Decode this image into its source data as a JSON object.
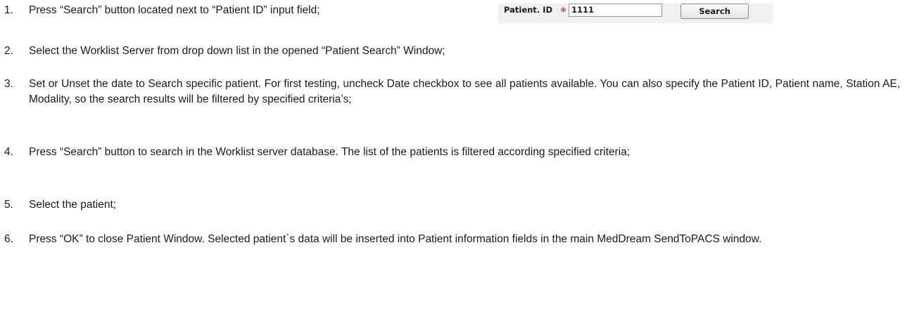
{
  "steps": [
    {
      "number": "1.",
      "text": "Press “Search” button located next to “Patient ID” input field;"
    },
    {
      "number": "2.",
      "text": "Select the Worklist Server from drop down list in the opened “Patient Search” Window;"
    },
    {
      "number": "3.",
      "text": "Set or Unset the date to Search specific patient. For first testing, uncheck Date checkbox to see all patients available. You can also specify the Patient ID, Patient name, Station AE, Modality, so the search results will be filtered by specified criteria’s;"
    },
    {
      "number": "4.",
      "text": "Press “Search” button to search in the Worklist server database. The list of the patients is filtered according specified criteria;"
    },
    {
      "number": "5.",
      "text": "Select the patient;"
    },
    {
      "number": "6.",
      "text": "Press “OK” to close Patient Window. Selected patient`s data will be inserted into Patient information fields in the main MedDream SendToPACS window."
    }
  ],
  "ui_snippet": {
    "label": "Patient. ID",
    "required_mark": "∗",
    "input_value": "1111",
    "button_label": "Search"
  }
}
